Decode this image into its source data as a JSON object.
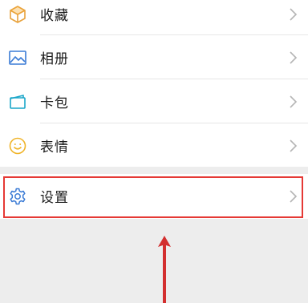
{
  "menu": {
    "items": [
      {
        "label": "收藏",
        "icon": "favorites-cube-icon"
      },
      {
        "label": "相册",
        "icon": "album-picture-icon"
      },
      {
        "label": "卡包",
        "icon": "card-wallet-icon"
      },
      {
        "label": "表情",
        "icon": "sticker-smiley-icon"
      }
    ],
    "settings": {
      "label": "设置",
      "icon": "gear-icon"
    }
  },
  "colors": {
    "highlight": "#e53935",
    "arrow": "#d32f2f",
    "background": "#ededed",
    "row_background": "#ffffff"
  }
}
